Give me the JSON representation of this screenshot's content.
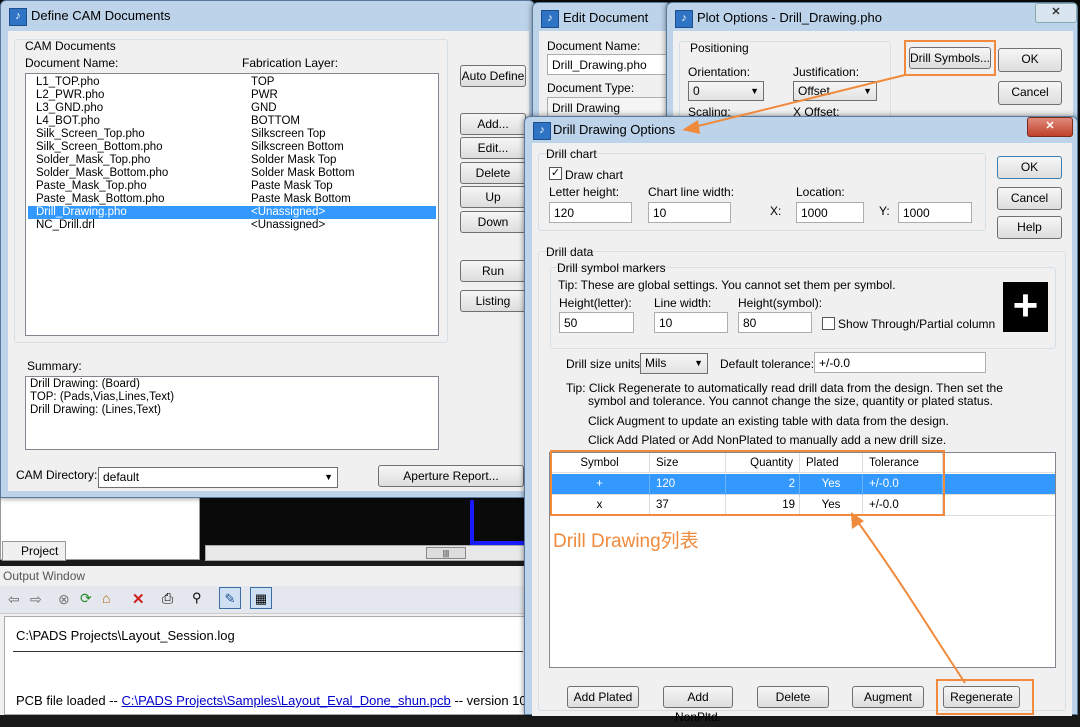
{
  "cam_window": {
    "title": "Define CAM Documents",
    "group_label": "CAM Documents",
    "col_doc_name": "Document Name:",
    "col_fab_layer": "Fabrication Layer:",
    "documents": [
      {
        "name": "L1_TOP.pho",
        "layer": "TOP"
      },
      {
        "name": "L2_PWR.pho",
        "layer": "PWR"
      },
      {
        "name": "L3_GND.pho",
        "layer": "GND"
      },
      {
        "name": "L4_BOT.pho",
        "layer": "BOTTOM"
      },
      {
        "name": "Silk_Screen_Top.pho",
        "layer": "Silkscreen Top"
      },
      {
        "name": "Silk_Screen_Bottom.pho",
        "layer": "Silkscreen Bottom"
      },
      {
        "name": "Solder_Mask_Top.pho",
        "layer": "Solder Mask Top"
      },
      {
        "name": "Solder_Mask_Bottom.pho",
        "layer": "Solder Mask Bottom"
      },
      {
        "name": "Paste_Mask_Top.pho",
        "layer": "Paste Mask Top"
      },
      {
        "name": "Paste_Mask_Bottom.pho",
        "layer": "Paste Mask Bottom"
      },
      {
        "name": "Drill_Drawing.pho",
        "layer": "<Unassigned>",
        "selected": true
      },
      {
        "name": "NC_Drill.drl",
        "layer": "<Unassigned>"
      }
    ],
    "buttons": {
      "auto_define": "Auto Define",
      "add": "Add...",
      "edit": "Edit...",
      "delete": "Delete",
      "up": "Up",
      "down": "Down",
      "run": "Run",
      "listing": "Listing"
    },
    "summary_label": "Summary:",
    "summary_lines": [
      "Drill Drawing: (Board)",
      "TOP: (Pads,Vias,Lines,Text)",
      "Drill Drawing: (Lines,Text)"
    ],
    "cam_directory_label": "CAM Directory:",
    "cam_directory_value": "default",
    "aperture_report": "Aperture Report..."
  },
  "edit_window": {
    "title": "Edit Document",
    "doc_name_label": "Document Name:",
    "doc_name_value": "Drill_Drawing.pho",
    "doc_type_label": "Document Type:",
    "doc_type_value": "Drill Drawing"
  },
  "plot_window": {
    "title": "Plot Options - Drill_Drawing.pho",
    "positioning_label": "Positioning",
    "orientation_label": "Orientation:",
    "orientation_value": "0",
    "justification_label": "Justification:",
    "justification_value": "Offset",
    "scaling_label": "Scaling:",
    "x_offset_label": "X Offset:",
    "drill_symbols": "Drill Symbols...",
    "ok": "OK",
    "cancel": "Cancel",
    "close_glyph": "✕"
  },
  "drill_window": {
    "title": "Drill Drawing Options",
    "close_glyph": "✕",
    "drill_chart_label": "Drill chart",
    "draw_chart_label": "Draw chart",
    "draw_chart_checked": true,
    "letter_height_label": "Letter height:",
    "letter_height_value": "120",
    "chart_line_width_label": "Chart line width:",
    "chart_line_width_value": "10",
    "location_label": "Location:",
    "x_label": "X:",
    "x_value": "1000",
    "y_label": "Y:",
    "y_value": "1000",
    "ok": "OK",
    "cancel": "Cancel",
    "help": "Help",
    "drill_data_label": "Drill data",
    "markers_label": "Drill symbol markers",
    "tip_markers": "Tip: These are global settings. You cannot set them per symbol.",
    "height_letter_label": "Height(letter):",
    "height_letter_value": "50",
    "line_width_label": "Line width:",
    "line_width_value": "10",
    "height_symbol_label": "Height(symbol):",
    "height_symbol_value": "80",
    "show_through_label": "Show Through/Partial column",
    "preview_symbol": "+",
    "drill_size_units_label": "Drill size units:",
    "drill_size_units_value": "Mils",
    "default_tolerance_label": "Default tolerance:",
    "default_tolerance_value": "+/-0.0",
    "tip_regenerate_1": "Tip: Click Regenerate to automatically read drill data from the design. Then set the",
    "tip_regenerate_2": "symbol and tolerance. You cannot change the size, quantity or plated status.",
    "tip_augment": "Click Augment to update an existing table with data from the design.",
    "tip_add": "Click Add Plated or Add NonPlated to manually add a new drill size.",
    "table_headers": [
      "Symbol",
      "Size",
      "Quantity",
      "Plated",
      "Tolerance"
    ],
    "table_rows": [
      {
        "symbol": "+",
        "size": "120",
        "quantity": "2",
        "plated": "Yes",
        "tolerance": "+/-0.0",
        "selected": true
      },
      {
        "symbol": "x",
        "size": "37",
        "quantity": "19",
        "plated": "Yes",
        "tolerance": "+/-0.0"
      }
    ],
    "annotation": "Drill Drawing列表",
    "buttons": {
      "add_plated": "Add Plated",
      "add_nonplated": "Add NonPltd.",
      "delete": "Delete",
      "augment": "Augment",
      "regenerate": "Regenerate"
    }
  },
  "background": {
    "project_tab": "Project",
    "output_window_title": "Output Window",
    "log_line": "C:\\PADS Projects\\Layout_Session.log",
    "pcb_loaded_prefix": "PCB file loaded -- ",
    "pcb_loaded_link": "C:\\PADS Projects\\Samples\\Layout_Eval_Done_shun.pcb",
    "pcb_loaded_suffix": " -- version 10",
    "scrollbar_glyph": "|||"
  },
  "accent_colors": {
    "annotation_orange": "#f08a3c",
    "selection_blue": "#3399ff",
    "link_blue": "#0000cc"
  }
}
